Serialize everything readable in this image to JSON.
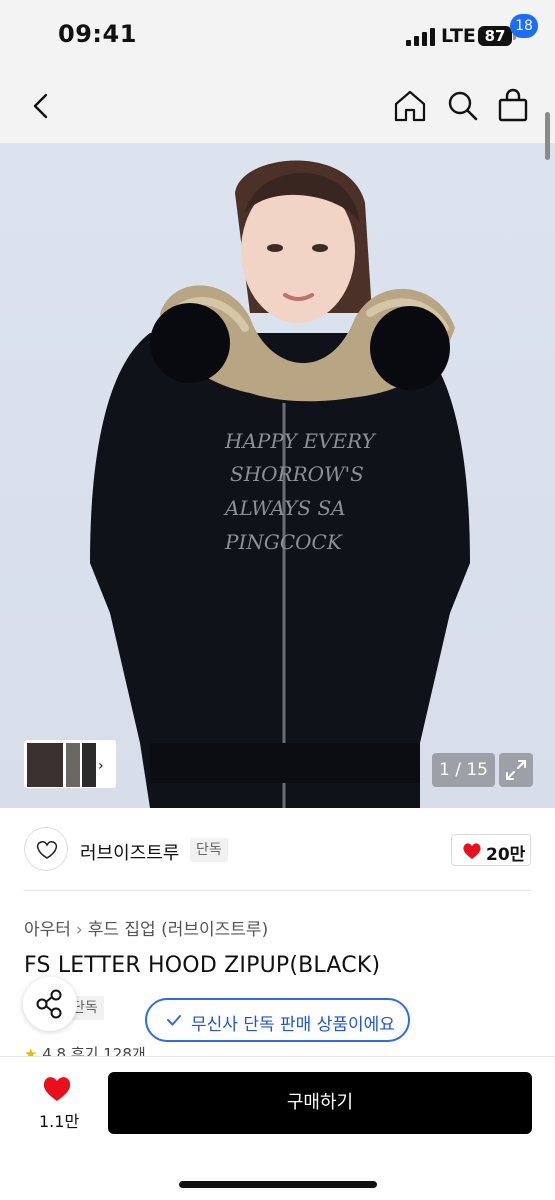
{
  "status": {
    "time": "09:41",
    "network": "LTE",
    "battery": "87"
  },
  "nav": {
    "cart_count": "18",
    "icons": [
      "back-icon",
      "home-icon",
      "search-icon",
      "shopping-bag-icon"
    ]
  },
  "gallery": {
    "counter": "1 / 15",
    "hero_text_art": "HAPPY EVERY / SHORROW'S / ALWAYS / PINGCOCK"
  },
  "brand": {
    "name": "러브이즈트루",
    "tag": "단독",
    "likes": "20만"
  },
  "product": {
    "breadcrumb": [
      "아우터",
      "후드 집업 (러브이즈트루)"
    ],
    "title": "FS LETTER HOOD ZIPUP(BLACK)",
    "exclusive_tag": "단독",
    "rating": "4.8",
    "reviews": "후기 128개"
  },
  "toast": {
    "text": "무신사 단독 판매 상품이에요"
  },
  "bottom": {
    "wish_count": "1.1만",
    "buy_label": "구매하기"
  },
  "colors": {
    "accent": "#1a6dff",
    "toast_border": "#2f6be6",
    "heart": "#e8101c",
    "buy_bg": "#000000"
  }
}
